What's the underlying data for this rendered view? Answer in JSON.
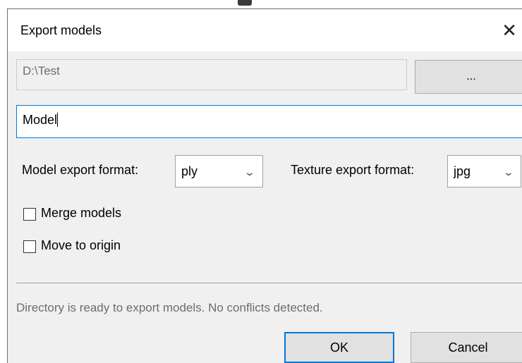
{
  "window": {
    "title": "Export models",
    "close_glyph": "✕"
  },
  "directory": {
    "path": "D:\\Test",
    "browse_label": "..."
  },
  "name_input": {
    "value": "Model"
  },
  "model_format": {
    "label": "Model export format:",
    "selected": "ply",
    "chevron": "⌄"
  },
  "texture_format": {
    "label": "Texture export format:",
    "selected": "jpg",
    "chevron": "⌄"
  },
  "options": {
    "merge_label": "Merge models",
    "merge_checked": false,
    "origin_label": "Move to origin",
    "origin_checked": false
  },
  "status": {
    "text": "Directory is ready to export models. No conflicts detected."
  },
  "buttons": {
    "ok_label": "OK",
    "cancel_label": "Cancel"
  },
  "colors": {
    "focus_accent": "#0078d7",
    "dialog_bg": "#f0f0f0",
    "button_bg": "#e1e1e1"
  },
  "icons": {
    "close": "close-icon",
    "dropdown": "chevron-down-icon"
  }
}
